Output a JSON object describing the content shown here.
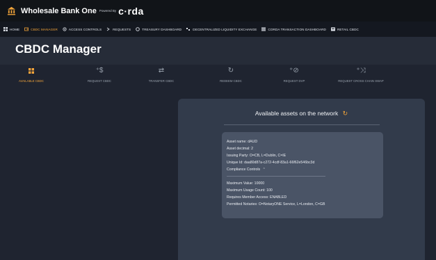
{
  "brand": {
    "title": "Wholesale Bank One",
    "powered_by": "Powered By",
    "corda": "c·rda"
  },
  "nav": [
    {
      "label": "HOME",
      "icon": "grid-icon",
      "active": false
    },
    {
      "label": "CBDC MANAGER",
      "icon": "wallet-icon",
      "active": true
    },
    {
      "label": "ACCESS CONTROLS",
      "icon": "settings-icon",
      "active": false
    },
    {
      "label": "REQUESTS",
      "icon": "arrow-icon",
      "active": false
    },
    {
      "label": "TREASURY DASHBOARD",
      "icon": "circle-icon",
      "active": false
    },
    {
      "label": "DECENTRALIZED LIQUIDITY EXCHANGE",
      "icon": "exchange-icon",
      "active": false
    },
    {
      "label": "CORDA TRANSACTION DASHBOARD",
      "icon": "list-icon",
      "active": false
    },
    {
      "label": "RETAIL CBDC",
      "icon": "card-icon",
      "active": false
    }
  ],
  "page_title": "CBDC Manager",
  "actions": [
    {
      "label": "AVAILABLE CBDC",
      "icon": "grid-icon",
      "active": true
    },
    {
      "label": "REQUEST CBDC",
      "icon": "plus-coin-icon",
      "active": false
    },
    {
      "label": "TRANSFER CBDC",
      "icon": "transfer-icon",
      "active": false
    },
    {
      "label": "REDEEM CBDC",
      "icon": "redeem-icon",
      "active": false
    },
    {
      "label": "REQUEST DVP",
      "icon": "plus-check-icon",
      "active": false
    },
    {
      "label": "REQUEST CROSS CHAIN SWAP",
      "icon": "plus-swap-icon",
      "active": false
    }
  ],
  "panel": {
    "title": "Available assets on the network",
    "asset": {
      "name": "Asset name: dAUD",
      "decimal": "Asset decimal: 2",
      "issuing_party": "Issuing Party: O=CB, L=Dublin, C=IE",
      "unique_id": "Unique Id: daa80d87a-c272-4cdf-83a1-66f62e546bc3d",
      "compliance_label": "Compliance Controls",
      "max_value": "Maximum Value: 10000",
      "max_usage": "Maximum Usage Count: 100",
      "requires_member": "Requires Member Access: ENABLED",
      "notaries": "Permitted Notaries: O=NotaryONE Service, L=London, C=GB"
    }
  },
  "colors": {
    "accent": "#f2a43a",
    "panel": "#323b4b",
    "card": "#4a5466"
  }
}
